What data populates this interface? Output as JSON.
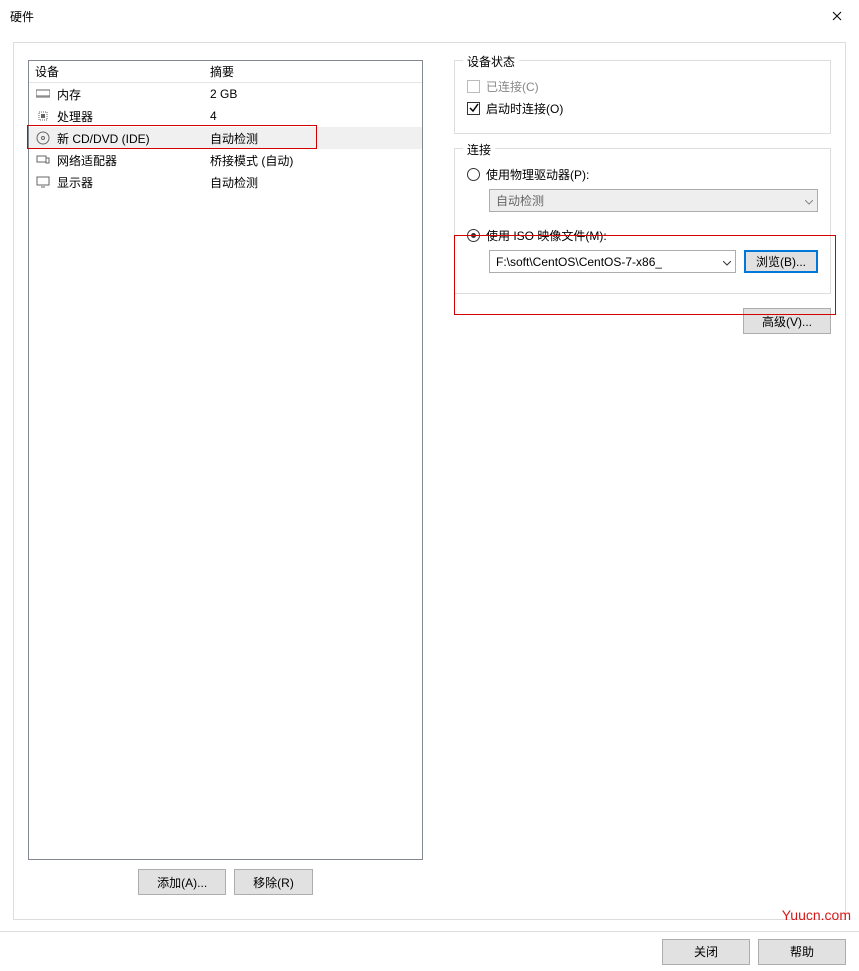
{
  "window": {
    "title": "硬件"
  },
  "device_list": {
    "cols": {
      "device": "设备",
      "summary": "摘要"
    },
    "rows": [
      {
        "icon": "memory-icon",
        "name": "内存",
        "summary": "2 GB",
        "selected": false
      },
      {
        "icon": "cpu-icon",
        "name": "处理器",
        "summary": "4",
        "selected": false
      },
      {
        "icon": "cd-icon",
        "name": "新 CD/DVD (IDE)",
        "summary": "自动检测",
        "selected": true
      },
      {
        "icon": "nic-icon",
        "name": "网络适配器",
        "summary": "桥接模式 (自动)",
        "selected": false
      },
      {
        "icon": "display-icon",
        "name": "显示器",
        "summary": "自动检测",
        "selected": false
      }
    ]
  },
  "buttons": {
    "add": "添加(A)...",
    "remove": "移除(R)",
    "advanced": "高级(V)...",
    "browse": "浏览(B)...",
    "close": "关闭",
    "help": "帮助"
  },
  "status_group": {
    "legend": "设备状态",
    "connected": {
      "label": "已连接(C)",
      "checked": false,
      "enabled": false
    },
    "connect_on": {
      "label": "启动时连接(O)",
      "checked": true
    }
  },
  "conn_group": {
    "legend": "连接",
    "physical": {
      "label": "使用物理驱动器(P):",
      "selected": false,
      "combo": "自动检测"
    },
    "iso": {
      "label": "使用 ISO 映像文件(M):",
      "selected": true,
      "path": "F:\\soft\\CentOS\\CentOS-7-x86_"
    }
  },
  "watermark": "Yuucn.com"
}
